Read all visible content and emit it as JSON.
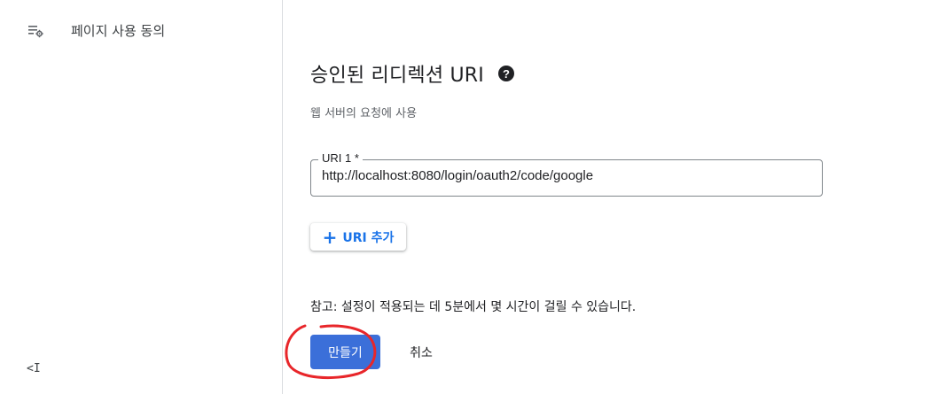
{
  "sidebar": {
    "items": [
      {
        "label": "페이지 사용 동의",
        "icon": "list-settings-icon"
      }
    ],
    "collapse_label": "<I",
    "collapse_icon": "collapse-sidebar-icon"
  },
  "section": {
    "title": "승인된 리디렉션 URI",
    "help_icon": "help-circle-icon",
    "help_glyph": "?",
    "subtitle": "웹 서버의 요청에 사용"
  },
  "uri_field": {
    "label": "URI 1 *",
    "value": "http://localhost:8080/login/oauth2/code/google"
  },
  "add_uri_button": {
    "label": "URI 추가",
    "icon": "plus-icon",
    "glyph": "+"
  },
  "note": "참고: 설정이 적용되는 데 5분에서 몇 시간이 걸릴 수 있습니다.",
  "actions": {
    "create_label": "만들기",
    "cancel_label": "취소"
  },
  "colors": {
    "primary": "#3b6fd9",
    "link": "#1a73e8",
    "annotation": "#e8262a",
    "border": "#80868b"
  }
}
